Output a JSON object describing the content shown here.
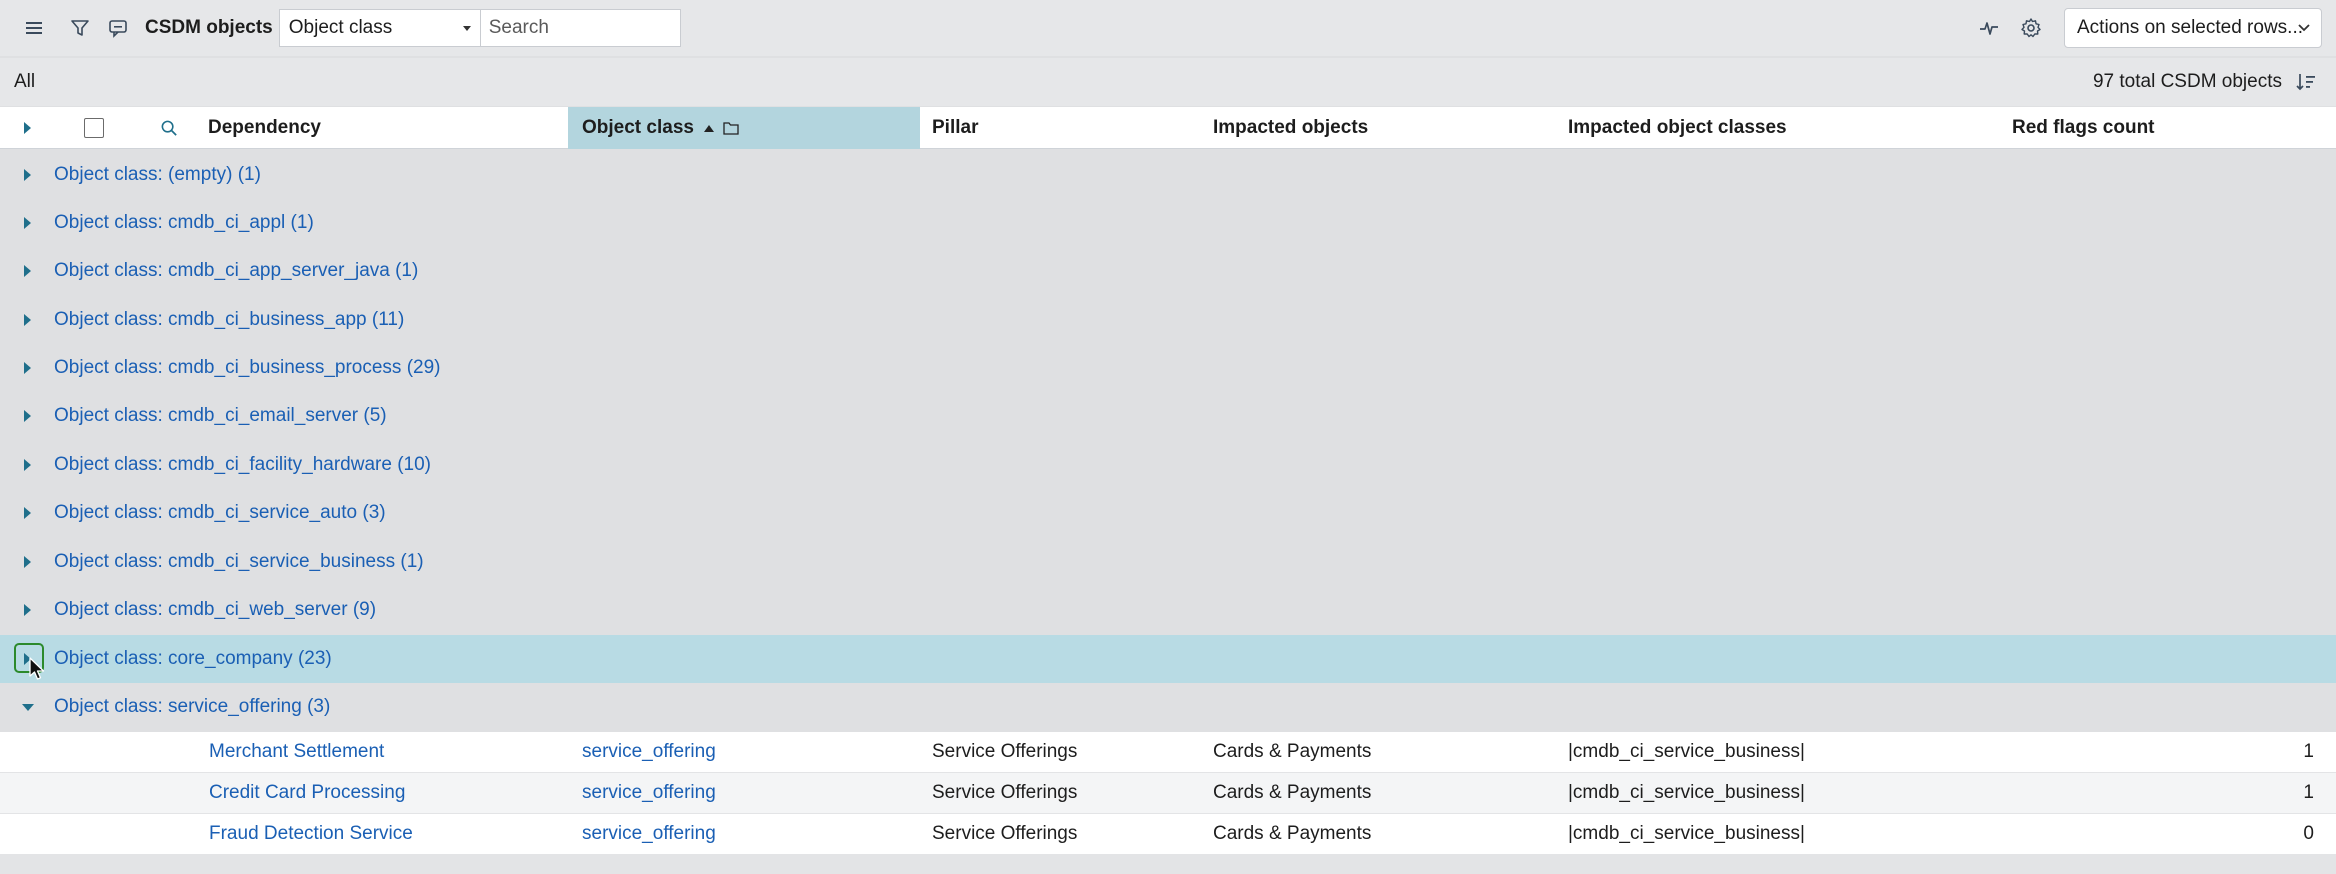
{
  "toolbar": {
    "list_title": "CSDM objects",
    "group_field_value": "Object class",
    "search_placeholder": "Search",
    "actions_label": "Actions on selected rows..."
  },
  "subbar": {
    "breadcrumb": "All",
    "total": "97 total CSDM objects"
  },
  "columns": {
    "dependency": "Dependency",
    "object_class": "Object class",
    "pillar": "Pillar",
    "impacted_objects": "Impacted objects",
    "impacted_object_classes": "Impacted object classes",
    "red_flags_count": "Red flags count"
  },
  "groups": [
    {
      "label": "Object class: (empty) (1)"
    },
    {
      "label": "Object class: cmdb_ci_appl (1)"
    },
    {
      "label": "Object class: cmdb_ci_app_server_java (1)"
    },
    {
      "label": "Object class: cmdb_ci_business_app (11)"
    },
    {
      "label": "Object class: cmdb_ci_business_process (29)"
    },
    {
      "label": "Object class: cmdb_ci_email_server (5)"
    },
    {
      "label": "Object class: cmdb_ci_facility_hardware (10)"
    },
    {
      "label": "Object class: cmdb_ci_service_auto (3)"
    },
    {
      "label": "Object class: cmdb_ci_service_business (1)"
    },
    {
      "label": "Object class: cmdb_ci_web_server (9)"
    },
    {
      "label": "Object class: core_company (23)"
    },
    {
      "label": "Object class: service_offering (3)"
    }
  ],
  "rows": [
    {
      "dependency": "Merchant Settlement",
      "object_class": "service_offering",
      "pillar": "Service Offerings",
      "impacted_objects": "Cards & Payments",
      "impacted_object_classes": "|cmdb_ci_service_business|",
      "red_flags_count": "1"
    },
    {
      "dependency": "Credit Card Processing",
      "object_class": "service_offering",
      "pillar": "Service Offerings",
      "impacted_objects": "Cards & Payments",
      "impacted_object_classes": "|cmdb_ci_service_business|",
      "red_flags_count": "1"
    },
    {
      "dependency": "Fraud Detection Service",
      "object_class": "service_offering",
      "pillar": "Service Offerings",
      "impacted_objects": "Cards & Payments",
      "impacted_object_classes": "|cmdb_ci_service_business|",
      "red_flags_count": "0"
    }
  ],
  "colors": {
    "link": "#1a5fb4",
    "selected_group": "#b8dbe4",
    "sorted_header": "#b3d5de"
  }
}
